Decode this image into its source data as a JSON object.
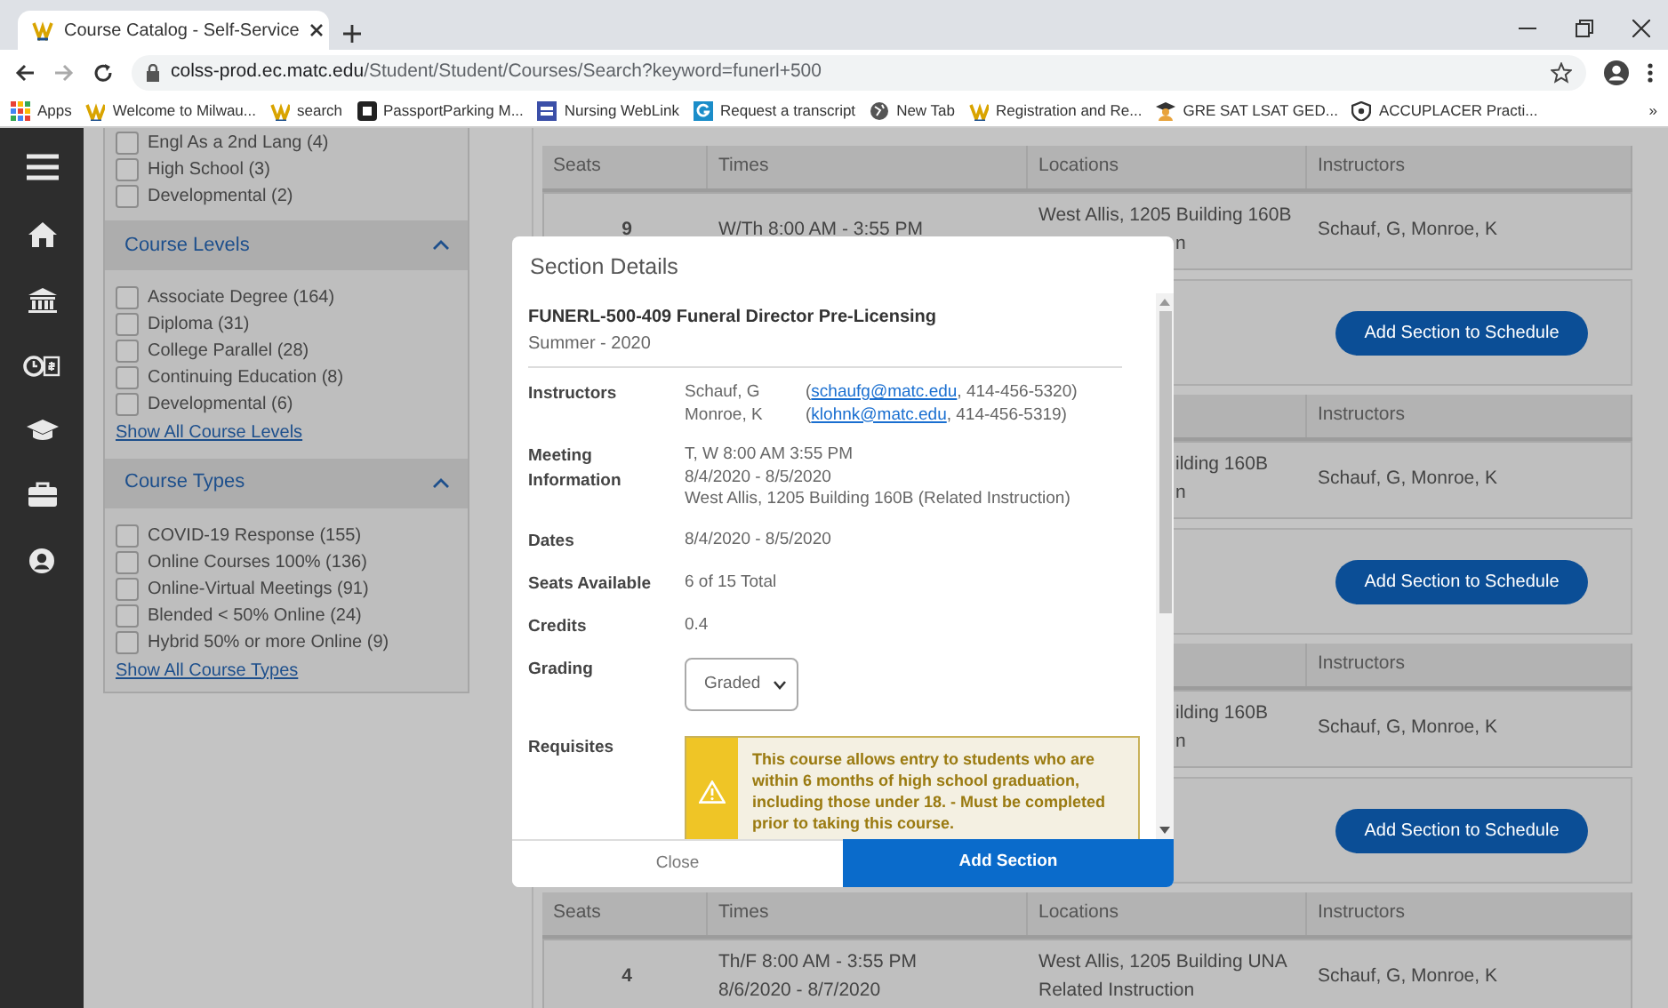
{
  "browser": {
    "tab_title": "Course Catalog - Self-Service",
    "url_domain": "colss-prod.ec.matc.edu",
    "url_path": "/Student/Student/Courses/Search?keyword=funerl+500",
    "bookmarks": [
      "Apps",
      "Welcome to Milwau...",
      "search",
      "PassportParking M...",
      "Nursing WebLink",
      "Request a transcript",
      "New Tab",
      "Registration and Re...",
      "GRE SAT LSAT GED...",
      "ACCUPLACER Practi..."
    ],
    "more": "»"
  },
  "filters": [
    {
      "items": [
        {
          "label": "Engl As a 2nd Lang (4)",
          "checked": false
        },
        {
          "label": "High School (3)",
          "checked": false
        },
        {
          "label": "Developmental (2)",
          "checked": false
        }
      ]
    },
    {
      "title": "Course Levels",
      "expanded": true,
      "items": [
        {
          "label": "Associate Degree (164)",
          "checked": false
        },
        {
          "label": "Diploma (31)",
          "checked": false
        },
        {
          "label": "College Parallel (28)",
          "checked": false
        },
        {
          "label": "Continuing Education (8)",
          "checked": false
        },
        {
          "label": "Developmental (6)",
          "checked": false
        }
      ],
      "link": "Show All Course Levels"
    },
    {
      "title": "Course Types",
      "expanded": true,
      "items": [
        {
          "label": "COVID-19 Response (155)",
          "checked": false
        },
        {
          "label": "Online Courses 100% (136)",
          "checked": false
        },
        {
          "label": "Online-Virtual Meetings (91)",
          "checked": false
        },
        {
          "label": "Blended < 50% Online (24)",
          "checked": false
        },
        {
          "label": "Hybrid 50% or more Online (9)",
          "checked": false
        }
      ],
      "link": "Show All Course Types"
    }
  ],
  "sections": [
    {
      "header": {
        "seats": "Seats",
        "times": "Times",
        "locations": "Locations",
        "instructors": "Instructors"
      },
      "row": {
        "seats": "9",
        "times": [
          "W/Th 8:00 AM - 3:55 PM"
        ],
        "locations": [
          {
            "text": "West Allis, 1205 Building 160B",
            "kind": "full"
          },
          {
            "text": "n",
            "kind": "partial"
          }
        ],
        "instructors": "Schauf, G, Monroe, K"
      },
      "button": "Add Section to Schedule"
    },
    {
      "header": {
        "instructors": "Instructors"
      },
      "row": {
        "locations": [
          {
            "text": "ilding 160B",
            "kind": "partial"
          },
          {
            "text": "n",
            "kind": "partial"
          }
        ],
        "instructors": "Schauf, G, Monroe, K"
      },
      "button": "Add Section to Schedule"
    },
    {
      "header": {
        "instructors": "Instructors"
      },
      "row": {
        "locations": [
          {
            "text": "ilding 160B",
            "kind": "partial"
          },
          {
            "text": "n",
            "kind": "partial"
          }
        ],
        "instructors": "Schauf, G, Monroe, K"
      },
      "button": "Add Section to Schedule"
    },
    {
      "header": {
        "seats": "Seats",
        "times": "Times",
        "locations": "Locations",
        "instructors": "Instructors"
      },
      "row": {
        "seats": "4",
        "times": [
          "Th/F 8:00 AM - 3:55 PM",
          "8/6/2020 - 8/7/2020"
        ],
        "locations": [
          {
            "text": "West Allis, 1205 Building UNA",
            "kind": "full"
          },
          {
            "text": "Related Instruction",
            "kind": "full"
          }
        ],
        "instructors": "Schauf, G, Monroe, K"
      }
    }
  ],
  "modal": {
    "title": "Section Details",
    "course_title": "FUNERL-500-409 Funeral Director Pre-Licensing",
    "term": "Summer - 2020",
    "fields": [
      {
        "kind": "instructors",
        "label": "Instructors",
        "instructors": [
          {
            "name": "Schauf, G",
            "open": "(",
            "email": "schaufg@matc.edu",
            "rest": ", 414-456-5320)"
          },
          {
            "name": "Monroe, K",
            "open": "(",
            "email": "klohnk@matc.edu",
            "rest": ", 414-456-5319)"
          }
        ]
      },
      {
        "kind": "text",
        "label": "Meeting Information",
        "lines": [
          "T, W 8:00 AM 3:55 PM",
          "8/4/2020 - 8/5/2020",
          "West Allis, 1205 Building 160B (Related Instruction)"
        ]
      },
      {
        "kind": "text",
        "label": "Dates",
        "lines": [
          "8/4/2020 - 8/5/2020"
        ]
      },
      {
        "kind": "text",
        "label": "Seats Available",
        "lines": [
          "6 of 15 Total"
        ]
      },
      {
        "kind": "text",
        "label": "Credits",
        "lines": [
          "0.4"
        ]
      },
      {
        "kind": "select",
        "label": "Grading",
        "value": "Graded"
      },
      {
        "kind": "alert",
        "label": "Requisites",
        "text": "This course allows entry to students who are within 6 months of high school graduation, including those under 18. - Must be completed prior to taking this course."
      }
    ],
    "buttons": [
      {
        "label": "Close",
        "primary": false
      },
      {
        "label": "Add Section",
        "primary": true
      }
    ]
  }
}
